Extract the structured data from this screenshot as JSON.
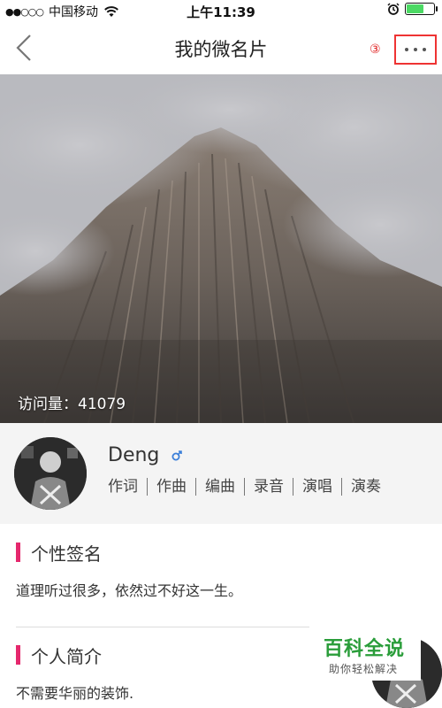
{
  "status_bar": {
    "signal_dots": "●●○○○",
    "carrier": "中国移动",
    "wifi_icon": "wifi-icon",
    "time": "上午11:39",
    "alarm_icon": "alarm-icon",
    "battery_icon": "battery-icon",
    "battery_level_fraction": 0.6,
    "battery_color": "#4cd964"
  },
  "nav": {
    "back_icon": "chevron-left-icon",
    "title": "我的微名片",
    "step_mark": "③",
    "more_icon": "more-dots-icon",
    "highlight_color": "#e33333"
  },
  "hero": {
    "visits_text": "访问量：41079"
  },
  "profile": {
    "name": "Deng",
    "gender_icon": "male-icon",
    "gender_color": "#3b7fd9",
    "tags": [
      "作词",
      "作曲",
      "编曲",
      "录音",
      "演唱",
      "演奏"
    ]
  },
  "signature": {
    "title": "个性签名",
    "text": "道理听过很多，依然过不好这一生。"
  },
  "intro": {
    "title": "个人简介",
    "text": "不需要华丽的装饰."
  },
  "watermark": {
    "brand": "百科全说",
    "slogan": "助你轻松解决",
    "color": "#2a9d3a"
  },
  "accent_color": "#e5286d"
}
